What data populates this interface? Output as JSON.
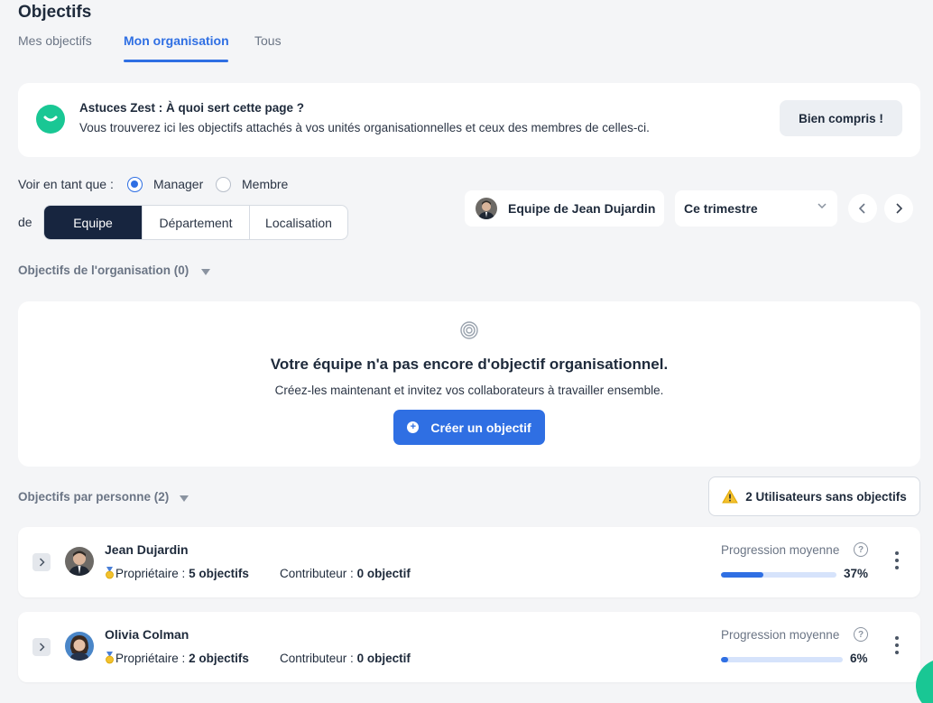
{
  "header": {
    "title": "Objectifs",
    "tabs": [
      {
        "label": "Mes objectifs",
        "active": false
      },
      {
        "label": "Mon organisation",
        "active": true
      },
      {
        "label": "Tous",
        "active": false
      }
    ]
  },
  "tip": {
    "title": "Astuces Zest : À quoi sert cette page ?",
    "text": "Vous trouverez ici les objectifs attachés à vos unités organisationnelles et ceux des membres de celles-ci.",
    "button": "Bien compris !"
  },
  "filters": {
    "view_as_label": "Voir en tant que :",
    "roles": [
      {
        "label": "Manager",
        "selected": true
      },
      {
        "label": "Membre",
        "selected": false
      }
    ],
    "de_label": "de",
    "scopes": [
      {
        "label": "Equipe",
        "selected": true
      },
      {
        "label": "Département",
        "selected": false
      },
      {
        "label": "Localisation",
        "selected": false
      }
    ],
    "team": "Equipe de Jean Dujardin",
    "period": "Ce trimestre"
  },
  "org_section": {
    "title": "Objectifs de l'organisation (0)",
    "empty_title": "Votre équipe n'a pas encore d'objectif organisationnel.",
    "empty_text": "Créez-les maintenant et invitez vos collaborateurs à travailler ensemble.",
    "create_button": "Créer un objectif"
  },
  "people_section": {
    "title": "Objectifs par personne (2)",
    "warning_button": "2 Utilisateurs sans objectifs",
    "progress_label": "Progression moyenne",
    "owner_label": "Propriétaire :",
    "contributor_label": "Contributeur :",
    "people": [
      {
        "name": "Jean Dujardin",
        "owner_count": "5 objectifs",
        "contributor_count": "0 objectif",
        "progress": 37,
        "progress_text": "37%"
      },
      {
        "name": "Olivia Colman",
        "owner_count": "2 objectifs",
        "contributor_count": "0 objectif",
        "progress": 6,
        "progress_text": "6%"
      }
    ]
  },
  "colors": {
    "accent": "#2f6fe3",
    "brand": "#19c794",
    "dark": "#17253f"
  }
}
